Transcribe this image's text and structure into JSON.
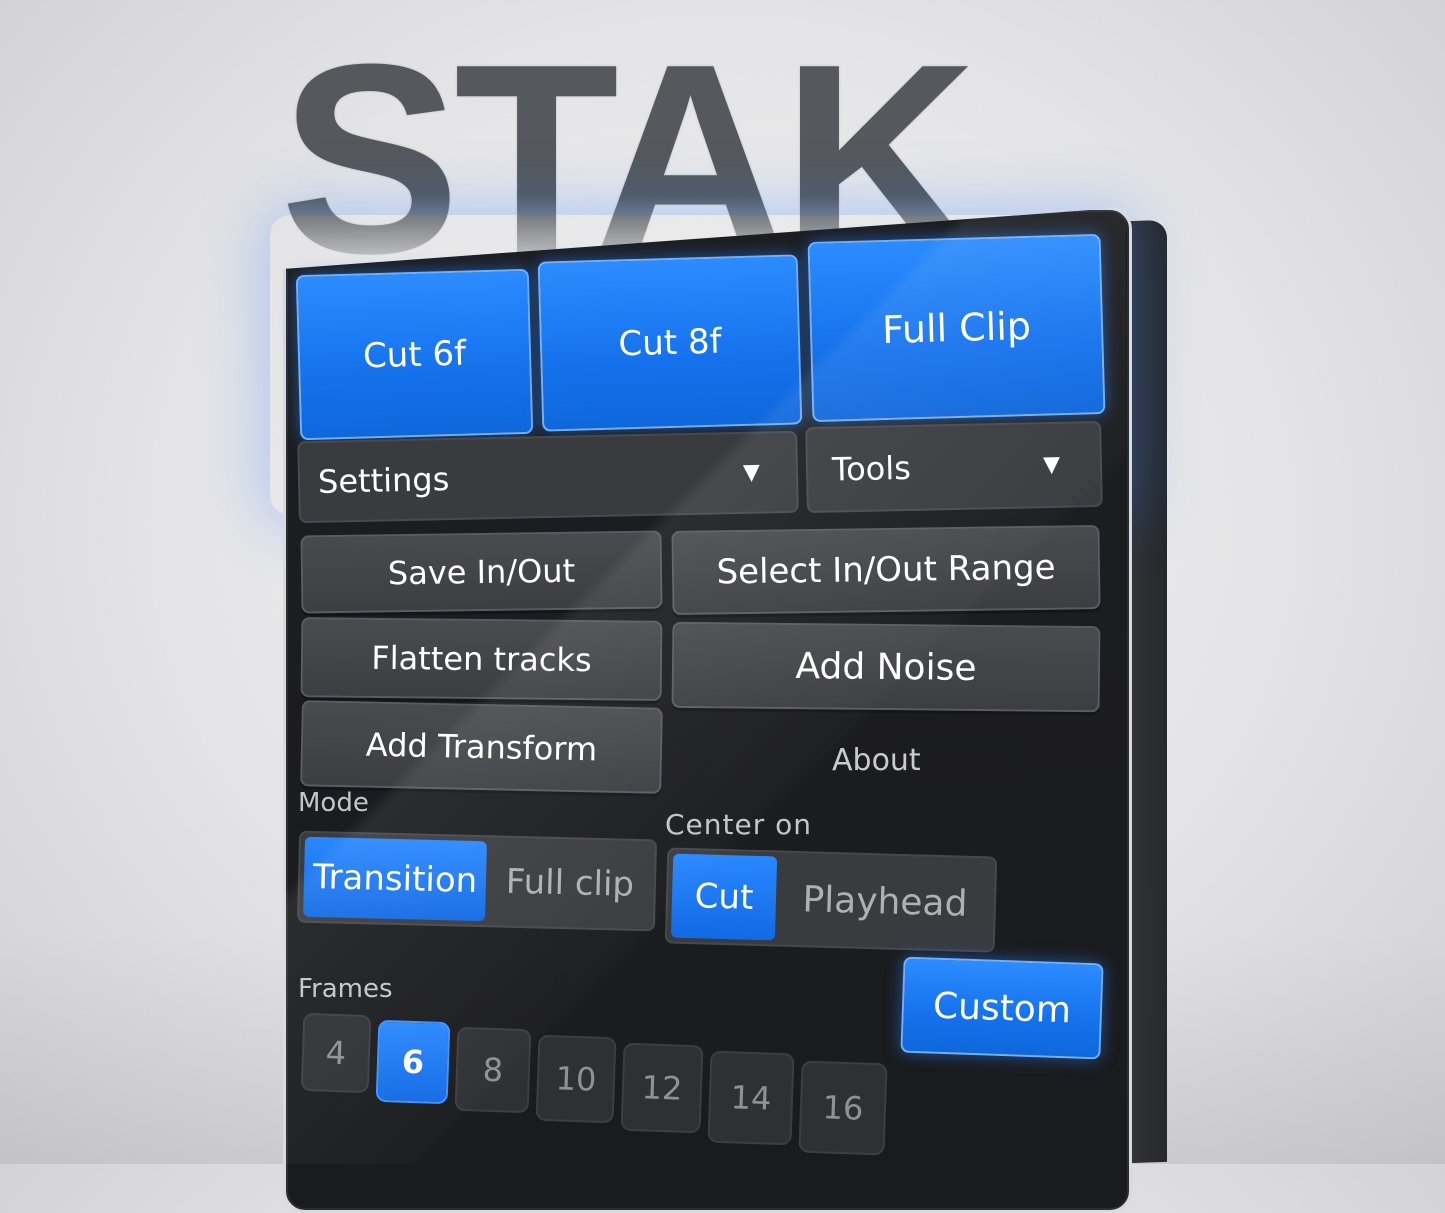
{
  "brand": {
    "title": "STAK"
  },
  "quick_actions": [
    {
      "label": "Cut 6f"
    },
    {
      "label": "Cut 8f"
    },
    {
      "label": "Full Clip"
    }
  ],
  "menus": {
    "settings": {
      "label": "Settings",
      "caret": "▼"
    },
    "tools": {
      "label": "Tools",
      "caret": "▼"
    }
  },
  "actions": {
    "save_in_out": "Save In/Out",
    "select_in_out_range": "Select In/Out Range",
    "flatten_tracks": "Flatten tracks",
    "add_noise": "Add Noise",
    "add_transform": "Add Transform",
    "about": "About"
  },
  "mode": {
    "label": "Mode",
    "options": [
      "Transition",
      "Full clip"
    ],
    "selected": "Transition"
  },
  "center_on": {
    "label": "Center on",
    "options": [
      "Cut",
      "Playhead"
    ],
    "selected": "Cut"
  },
  "frames": {
    "label": "Frames",
    "options": [
      "4",
      "6",
      "8",
      "10",
      "12",
      "14",
      "16"
    ],
    "selected": "6",
    "custom_label": "Custom"
  },
  "colors": {
    "accent": "#1572ec",
    "panel": "#1d1e21",
    "button": "#3d3e42"
  }
}
